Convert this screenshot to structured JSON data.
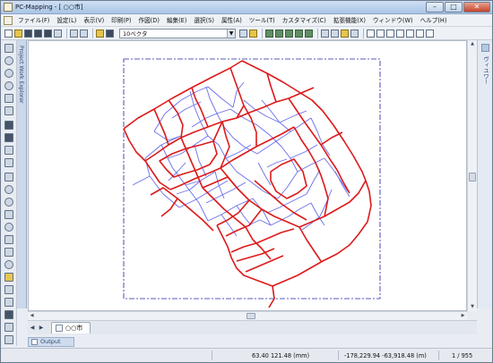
{
  "window": {
    "title": "PC-Mapping - [ ○○市]",
    "controls": {
      "minimize": "–",
      "maximize": "□",
      "close": "✕"
    }
  },
  "menu": [
    "ファイル(F)",
    "設定(L)",
    "表示(V)",
    "印刷(P)",
    "作図(D)",
    "編集(E)",
    "選択(S)",
    "属性(A)",
    "ツール(T)",
    "カスタマイズ(C)",
    "拡張機能(X)",
    "ウィンドウ(W)",
    "ヘルプ(H)"
  ],
  "toolbar": {
    "layer_select_value": "10ベクタ",
    "dropdown_arrow": "▼"
  },
  "panels": {
    "left_tab": "Project Work Explorer",
    "right_tab": "ヴィユワー"
  },
  "scroll": {
    "up": "▲",
    "down": "▼",
    "left": "◀",
    "right": "▶"
  },
  "document_tabs": {
    "prev": "◀",
    "next": "▶",
    "active_tab": "○○市"
  },
  "output_panel": {
    "label": "Output"
  },
  "status": {
    "cursor_mm": "63.40 121.48 (mm)",
    "cursor_m": "-178,229.94 -63,918.48 (m)",
    "selection_count": "1 / 955"
  },
  "colors": {
    "map_red": "#dd1a1a",
    "map_blue": "#6a6ee8",
    "frame_dash": "#5b5bbf"
  }
}
